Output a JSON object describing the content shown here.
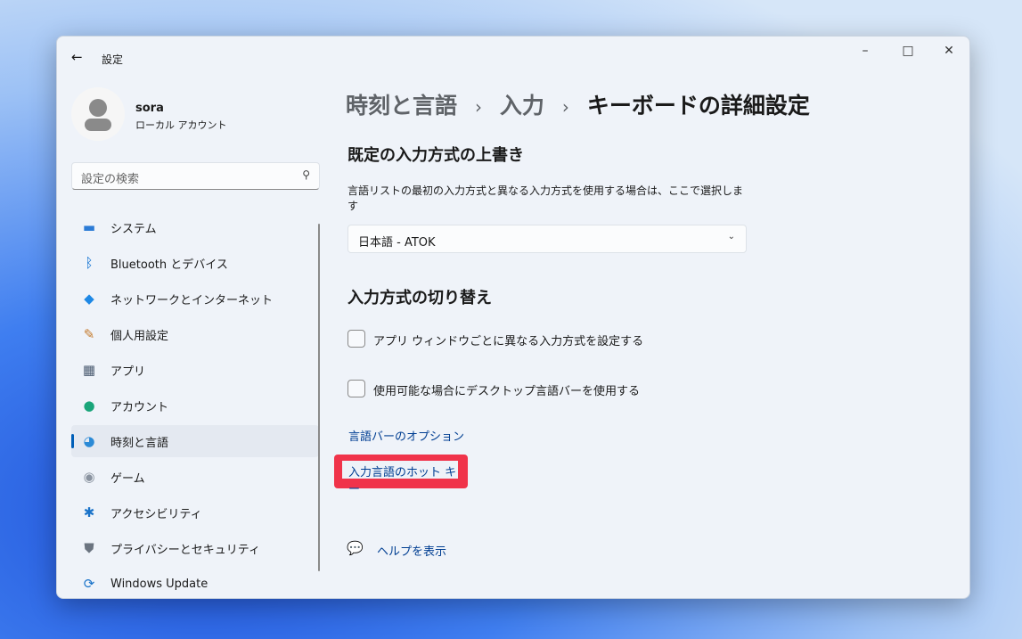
{
  "window": {
    "title": "設定",
    "minimize": "–",
    "maximize": "□",
    "close": "✕"
  },
  "user": {
    "name": "sora",
    "type": "ローカル アカウント"
  },
  "search": {
    "placeholder": "設定の検索"
  },
  "nav": [
    {
      "label": "システム",
      "icon": "monitor-icon",
      "color": "#2b7bd6"
    },
    {
      "label": "Bluetooth とデバイス",
      "icon": "bluetooth-icon",
      "color": "#0a6ed1"
    },
    {
      "label": "ネットワークとインターネット",
      "icon": "wifi-icon",
      "color": "#1e88e5"
    },
    {
      "label": "個人用設定",
      "icon": "brush-icon",
      "color": "#c47a2c"
    },
    {
      "label": "アプリ",
      "icon": "apps-icon",
      "color": "#4a5a70"
    },
    {
      "label": "アカウント",
      "icon": "account-icon",
      "color": "#1aa57a"
    },
    {
      "label": "時刻と言語",
      "icon": "globe-clock-icon",
      "color": "#2b8ad6"
    },
    {
      "label": "ゲーム",
      "icon": "gamepad-icon",
      "color": "#8a93a0"
    },
    {
      "label": "アクセシビリティ",
      "icon": "accessibility-icon",
      "color": "#1a73c9"
    },
    {
      "label": "プライバシーとセキュリティ",
      "icon": "shield-icon",
      "color": "#6b7480"
    },
    {
      "label": "Windows Update",
      "icon": "update-icon",
      "color": "#1a73c9"
    }
  ],
  "breadcrumb": {
    "part1": "時刻と言語",
    "part2": "入力",
    "current": "キーボードの詳細設定",
    "sep": "›"
  },
  "override": {
    "heading": "既定の入力方式の上書き",
    "desc": "言語リストの最初の入力方式と異なる入力方式を使用する場合は、ここで選択します",
    "selected": "日本語 - ATOK"
  },
  "switching": {
    "heading": "入力方式の切り替え",
    "option1": "アプリ ウィンドウごとに異なる入力方式を設定する",
    "option2": "使用可能な場合にデスクトップ言語バーを使用する",
    "option1_checked": false,
    "option2_checked": false
  },
  "links": {
    "langbar": "言語バーのオプション",
    "hotkeys": "入力言語のホット キー"
  },
  "help": {
    "label": "ヘルプを表示"
  },
  "highlight_color": "#f0334a"
}
